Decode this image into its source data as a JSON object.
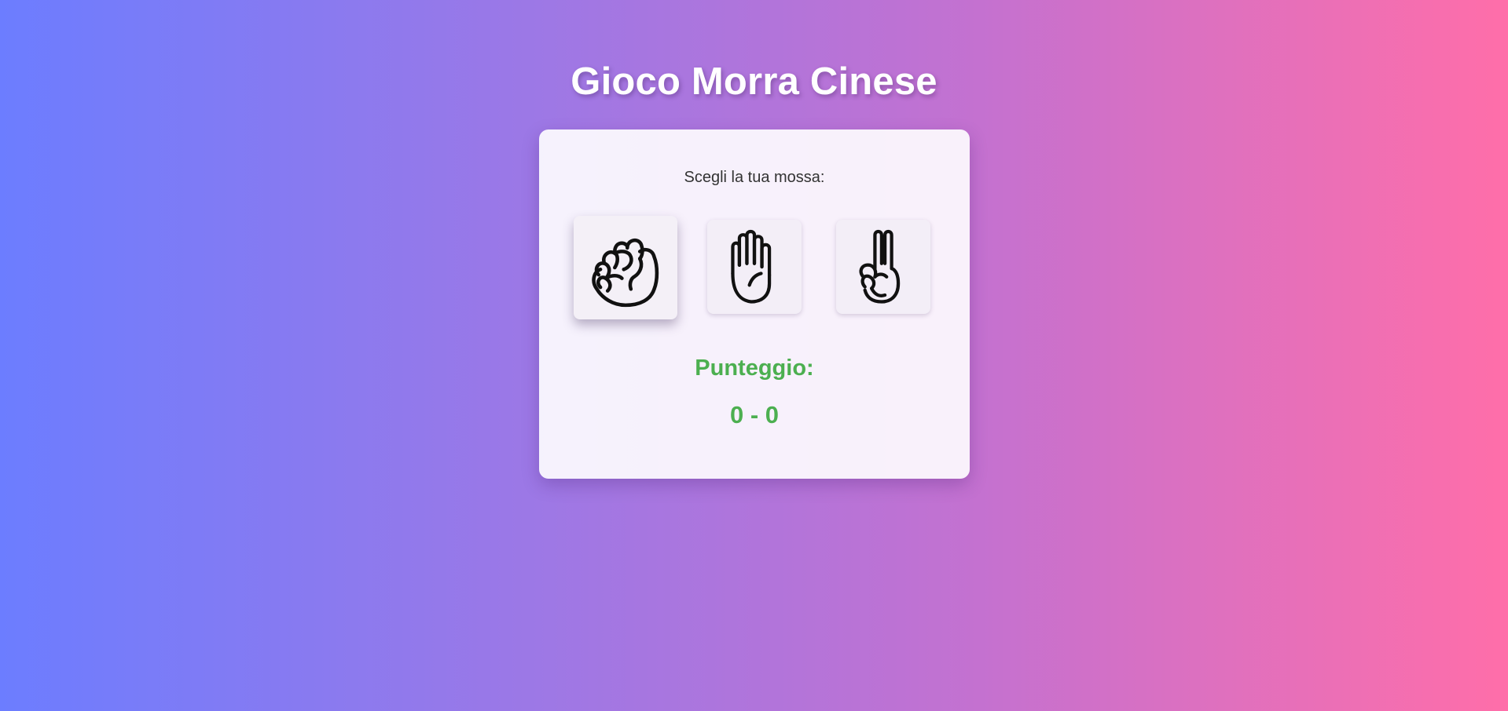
{
  "page": {
    "title": "Gioco Morra Cinese"
  },
  "game": {
    "prompt": "Scegli la tua mossa:",
    "choices": [
      {
        "name": "rock",
        "icon": "fist-icon",
        "selected": true
      },
      {
        "name": "paper",
        "icon": "open-hand-icon",
        "selected": false
      },
      {
        "name": "scissors",
        "icon": "victory-hand-icon",
        "selected": false
      }
    ],
    "score_label": "Punteggio:",
    "score_value": "0 - 0"
  },
  "colors": {
    "gradient_start": "#6c7dff",
    "gradient_end": "#ff6ea9",
    "score_green": "#4caf50",
    "card_bg": "#f7f2fa"
  }
}
